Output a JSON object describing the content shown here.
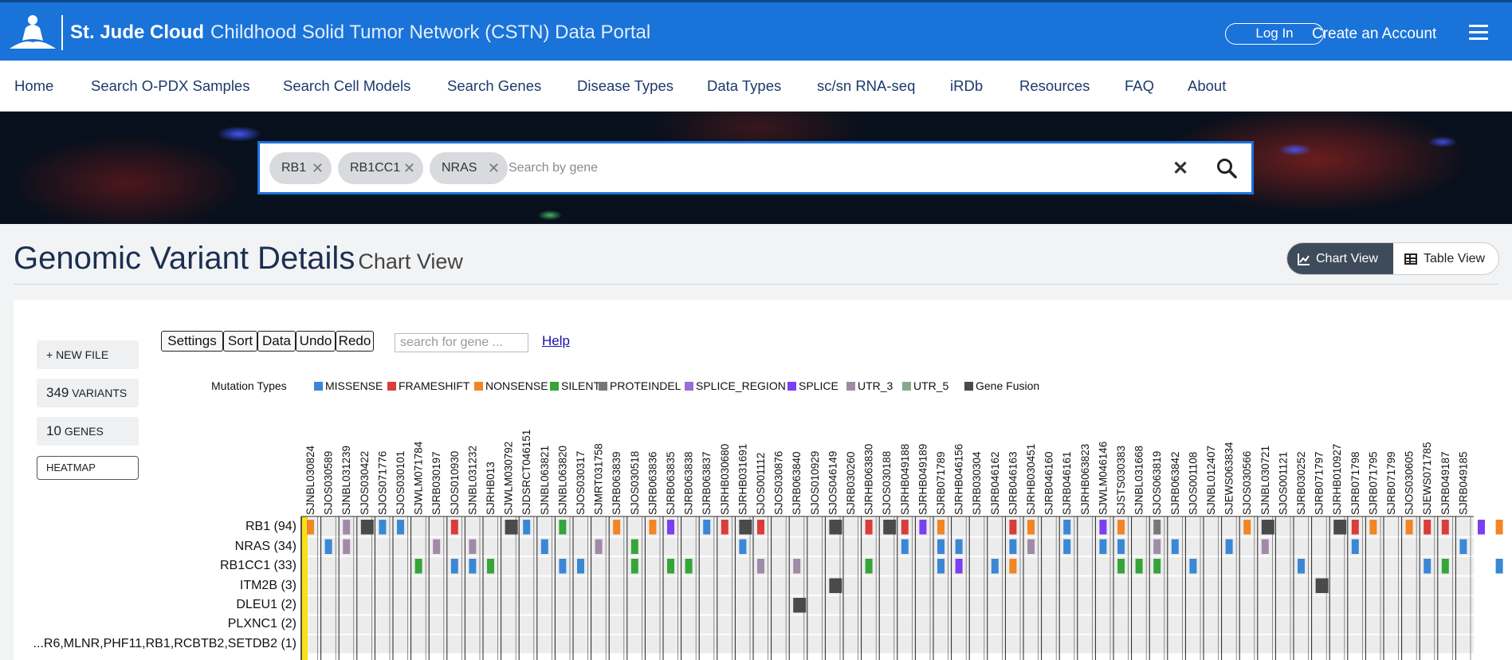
{
  "header": {
    "brand_name": "St. Jude Cloud",
    "portal_name": "Childhood Solid Tumor Network (CSTN) Data Portal",
    "login_label": "Log In",
    "create_account_label": "Create an Account"
  },
  "nav": [
    "Home",
    "Search O-PDX Samples",
    "Search Cell Models",
    "Search Genes",
    "Disease Types",
    "Data Types",
    "sc/sn RNA-seq",
    "iRDb",
    "Resources",
    "FAQ",
    "About"
  ],
  "search": {
    "chips": [
      "RB1",
      "RB1CC1",
      "NRAS"
    ],
    "placeholder": "Search by gene"
  },
  "page": {
    "title": "Genomic Variant Details",
    "subtitle": "Chart View",
    "chart_view_label": "Chart View",
    "table_view_label": "Table View"
  },
  "sidebar": {
    "new_file_label": "+ NEW FILE",
    "variants_count": "349",
    "variants_label": "VARIANTS",
    "genes_count": "10",
    "genes_label": "GENES",
    "heatmap_label": "HEATMAP"
  },
  "toolbar": {
    "buttons": [
      "Settings",
      "Sort",
      "Data",
      "Undo",
      "Redo"
    ],
    "gene_search_placeholder": "search for gene ...",
    "help_label": "Help"
  },
  "legend": {
    "title": "Mutation Types",
    "items": [
      {
        "label": "MISSENSE",
        "color": "#3a87d6"
      },
      {
        "label": "FRAMESHIFT",
        "color": "#db3b3b"
      },
      {
        "label": "NONSENSE",
        "color": "#f28524"
      },
      {
        "label": "SILENT",
        "color": "#35a53a"
      },
      {
        "label": "PROTEINDEL",
        "color": "#777777"
      },
      {
        "label": "SPLICE_REGION",
        "color": "#9b6dd6"
      },
      {
        "label": "SPLICE",
        "color": "#7b3ff2"
      },
      {
        "label": "UTR_3",
        "color": "#a08aa8"
      },
      {
        "label": "UTR_5",
        "color": "#8aa88a"
      },
      {
        "label": "Gene Fusion",
        "color": "#4a4a4a"
      }
    ]
  },
  "chart_data": {
    "type": "heatmap",
    "title": "",
    "rows": [
      "RB1 (94)",
      "NRAS (34)",
      "RB1CC1 (33)",
      "ITM2B (3)",
      "DLEU1 (2)",
      "PLXNC1 (2)",
      "...R6,MLNR,PHF11,RB1,RCBTB2,SETDB2 (1)"
    ],
    "columns": [
      "SJNBL030824",
      "SJOS030589",
      "SJNBL031239",
      "SJOS030422",
      "SJOS071776",
      "SJOS030101",
      "SJWLM071784",
      "SJRB030197",
      "SJOS010930",
      "SJNBL031232",
      "SJRHB013",
      "SJWLM030792",
      "SJDSRCT046151",
      "SJNBL063821",
      "SJNBL063820",
      "SJOS030317",
      "SJMRT031758",
      "SJRB063839",
      "SJOS030518",
      "SJRB063836",
      "SJRB063835",
      "SJRB063838",
      "SJRB063837",
      "SJRHB030680",
      "SJRHB031691",
      "SJOS001112",
      "SJOS030876",
      "SJRB063840",
      "SJOS010929",
      "SJOS046149",
      "SJRB030260",
      "SJRHB063830",
      "SJOS030188",
      "SJRHB049188",
      "SJRHB049189",
      "SJRB071789",
      "SJRHB046156",
      "SJRB030304",
      "SJRB046162",
      "SJRB046163",
      "SJRHB030451",
      "SJRB046160",
      "SJRB046161",
      "SJRHB063823",
      "SJWLM046146",
      "SJSTS030383",
      "SJNBL031668",
      "SJOS063819",
      "SJRB063842",
      "SJOS001108",
      "SJNBL012407",
      "SJEWS063834",
      "SJOS030566",
      "SJNBL030721",
      "SJOS001121",
      "SJRB030252",
      "SJRB071797",
      "SJRHB010927",
      "SJRB071798",
      "SJRB071795",
      "SJRB071799",
      "SJOS030605",
      "SJEWS071785",
      "SJRB049187",
      "SJRB049185"
    ],
    "cells": [
      [
        0,
        0,
        "nonsense"
      ],
      [
        0,
        2,
        "utr3"
      ],
      [
        0,
        3,
        "fusion"
      ],
      [
        0,
        4,
        "missense"
      ],
      [
        0,
        5,
        "missense"
      ],
      [
        0,
        8,
        "frameshift"
      ],
      [
        0,
        11,
        "fusion"
      ],
      [
        0,
        12,
        "missense"
      ],
      [
        0,
        14,
        "silent"
      ],
      [
        0,
        17,
        "nonsense"
      ],
      [
        0,
        19,
        "nonsense"
      ],
      [
        0,
        20,
        "splice"
      ],
      [
        0,
        22,
        "missense"
      ],
      [
        0,
        23,
        "frameshift"
      ],
      [
        0,
        24,
        "fusion"
      ],
      [
        0,
        25,
        "frameshift"
      ],
      [
        0,
        29,
        "fusion"
      ],
      [
        0,
        31,
        "frameshift"
      ],
      [
        0,
        32,
        "fusion"
      ],
      [
        0,
        33,
        "frameshift"
      ],
      [
        0,
        34,
        "splice"
      ],
      [
        0,
        35,
        "nonsense"
      ],
      [
        0,
        39,
        "frameshift"
      ],
      [
        0,
        40,
        "nonsense"
      ],
      [
        0,
        42,
        "missense"
      ],
      [
        0,
        44,
        "splice"
      ],
      [
        0,
        45,
        "nonsense"
      ],
      [
        0,
        47,
        "proteindel"
      ],
      [
        0,
        52,
        "nonsense"
      ],
      [
        0,
        53,
        "fusion"
      ],
      [
        0,
        57,
        "fusion"
      ],
      [
        0,
        58,
        "frameshift"
      ],
      [
        0,
        59,
        "nonsense"
      ],
      [
        0,
        61,
        "nonsense"
      ],
      [
        0,
        62,
        "frameshift"
      ],
      [
        0,
        63,
        "frameshift"
      ],
      [
        0,
        65,
        "splice"
      ],
      [
        0,
        66,
        "nonsense"
      ],
      [
        1,
        1,
        "missense"
      ],
      [
        1,
        2,
        "utr3"
      ],
      [
        1,
        7,
        "utr3"
      ],
      [
        1,
        9,
        "utr3"
      ],
      [
        1,
        13,
        "missense"
      ],
      [
        1,
        16,
        "utr3"
      ],
      [
        1,
        18,
        "silent"
      ],
      [
        1,
        24,
        "missense"
      ],
      [
        1,
        33,
        "missense"
      ],
      [
        1,
        35,
        "missense"
      ],
      [
        1,
        36,
        "missense"
      ],
      [
        1,
        39,
        "missense"
      ],
      [
        1,
        40,
        "utr3"
      ],
      [
        1,
        42,
        "missense"
      ],
      [
        1,
        44,
        "missense"
      ],
      [
        1,
        45,
        "missense"
      ],
      [
        1,
        47,
        "utr3"
      ],
      [
        1,
        48,
        "missense"
      ],
      [
        1,
        51,
        "missense"
      ],
      [
        1,
        53,
        "utr3"
      ],
      [
        1,
        58,
        "missense"
      ],
      [
        1,
        64,
        "missense"
      ],
      [
        2,
        6,
        "silent"
      ],
      [
        2,
        8,
        "missense"
      ],
      [
        2,
        9,
        "missense"
      ],
      [
        2,
        10,
        "silent"
      ],
      [
        2,
        14,
        "missense"
      ],
      [
        2,
        15,
        "missense"
      ],
      [
        2,
        18,
        "silent"
      ],
      [
        2,
        20,
        "silent"
      ],
      [
        2,
        21,
        "silent"
      ],
      [
        2,
        25,
        "utr3"
      ],
      [
        2,
        27,
        "utr3"
      ],
      [
        2,
        31,
        "silent"
      ],
      [
        2,
        35,
        "missense"
      ],
      [
        2,
        36,
        "splice"
      ],
      [
        2,
        38,
        "missense"
      ],
      [
        2,
        39,
        "nonsense"
      ],
      [
        2,
        45,
        "silent"
      ],
      [
        2,
        46,
        "silent"
      ],
      [
        2,
        47,
        "silent"
      ],
      [
        2,
        49,
        "missense"
      ],
      [
        2,
        55,
        "missense"
      ],
      [
        2,
        62,
        "missense"
      ],
      [
        2,
        63,
        "silent"
      ],
      [
        2,
        66,
        "missense"
      ],
      [
        3,
        29,
        "fusion"
      ],
      [
        3,
        56,
        "fusion"
      ],
      [
        4,
        27,
        "fusion"
      ]
    ]
  }
}
